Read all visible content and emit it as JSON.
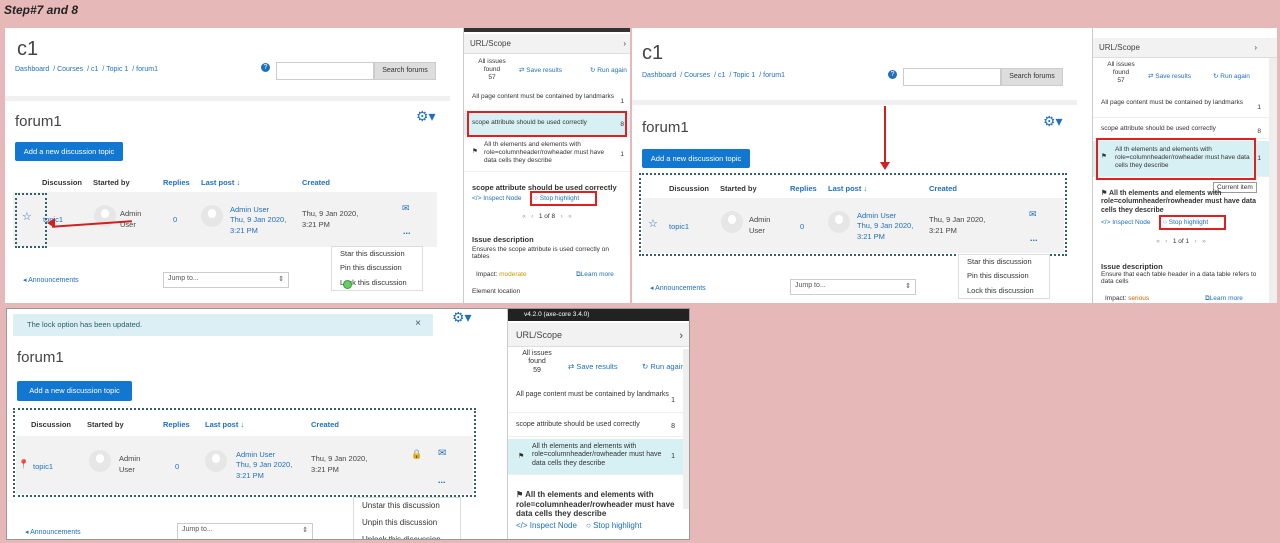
{
  "step_label": "Step#7 and 8",
  "course": {
    "title": "c1",
    "breadcrumb": [
      "Dashboard",
      "Courses",
      "c1",
      "Topic 1",
      "forum1"
    ],
    "search_button": "Search forums"
  },
  "forum": {
    "title": "forum1",
    "add_button": "Add a new discussion topic",
    "columns": {
      "discussion": "Discussion",
      "started_by": "Started by",
      "replies": "Replies",
      "last_post": "Last post",
      "created": "Created"
    },
    "row": {
      "topic": "topic1",
      "started_by": "Admin User",
      "replies": "0",
      "last_post_user": "Admin User",
      "last_post_date": "Thu, 9 Jan 2020, 3:21 PM",
      "created": "Thu, 9 Jan 2020, 3:21 PM"
    },
    "announcements": "Announcements",
    "jump_to": "Jump to...",
    "more": "...",
    "menu_a": [
      "Star this discussion",
      "Pin this discussion",
      "Lock this discussion"
    ],
    "menu_b": [
      "Unstar this discussion",
      "Unpin this discussion",
      "Unlock this discussion"
    ],
    "notice": "The lock option has been updated.",
    "close": "×"
  },
  "axe": {
    "url_scope": "URL/Scope",
    "all_issues": "All issues",
    "found": "found",
    "count_1": "57",
    "count_2": "57",
    "count_3": "59",
    "save_results": "Save results",
    "run_again": "Run again",
    "issues": [
      {
        "text": "All page content must be contained by landmarks",
        "count": "1"
      },
      {
        "text": "scope attribute should be used correctly",
        "count": "8"
      },
      {
        "text": "All th elements and elements with role=columnheader/rowheader must have data cells they describe",
        "count": "1"
      }
    ],
    "detail_title_1": "scope attribute should be used correctly",
    "detail_title_2": "All th elements and elements with role=columnheader/rowheader must have data cells they describe",
    "inspect_node": "Inspect Node",
    "stop_highlight": "Stop highlight",
    "pager_1": "1 of 8",
    "pager_2": "1 of 1",
    "issue_description": "Issue description",
    "desc_1": "Ensures the scope attribute is used correctly on tables",
    "desc_2": "Ensure that each table header in a data table refers to data cells",
    "impact_label": "Impact:",
    "impact_1": "moderate",
    "impact_2": "serious",
    "learn_more": "Learn more",
    "element_location": "Element location",
    "current_item": "Current item",
    "version": "v4.2.0 (axe-core 3.4.0)"
  }
}
